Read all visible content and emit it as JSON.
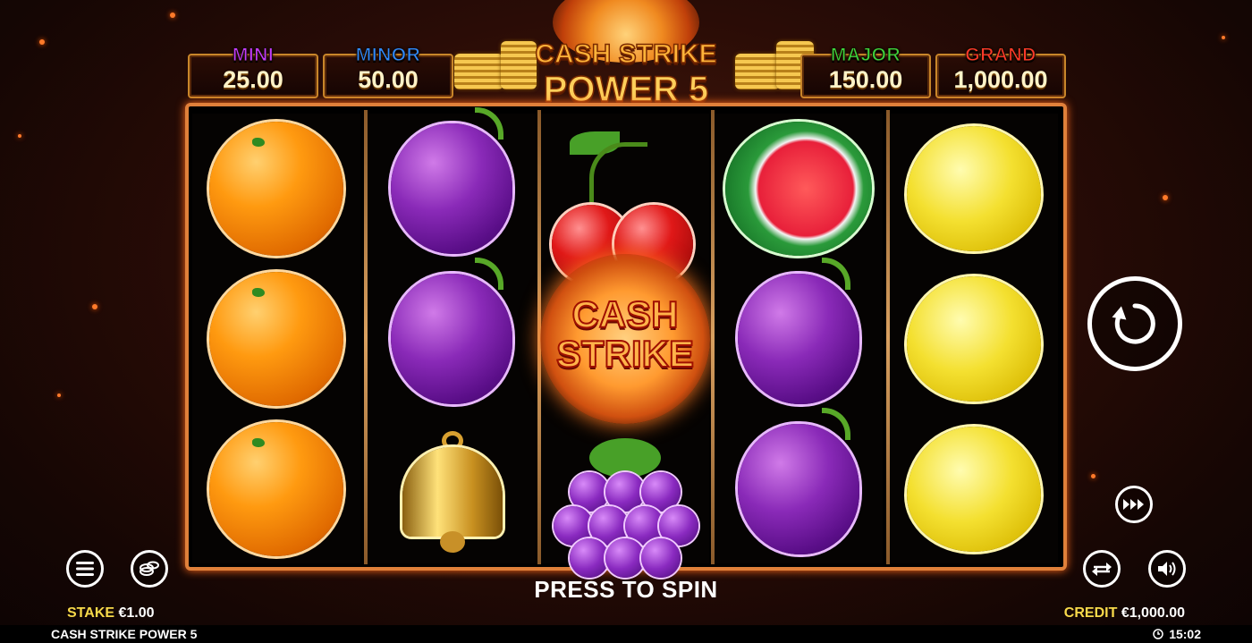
{
  "jackpots": [
    {
      "label": "MINI",
      "value": "25.00",
      "color": "#c23cff"
    },
    {
      "label": "MINOR",
      "value": "50.00",
      "color": "#2e8bff"
    },
    {
      "label": "MAJOR",
      "value": "150.00",
      "color": "#3cd43c"
    },
    {
      "label": "GRAND",
      "value": "1,000.00",
      "color": "#ff3a2a"
    }
  ],
  "logo": {
    "line1": "CASH STRIKE",
    "line2": "POWER 5"
  },
  "reels": [
    [
      "orange",
      "orange",
      "orange"
    ],
    [
      "plum",
      "plum",
      "bell"
    ],
    [
      "cherry",
      "cash-strike",
      "grapes"
    ],
    [
      "watermelon",
      "plum",
      "plum"
    ],
    [
      "lemon",
      "lemon",
      "lemon"
    ]
  ],
  "cash_strike_symbol": {
    "line1": "CASH",
    "line2": "STRIKE"
  },
  "press_to_spin": "PRESS TO SPIN",
  "stake": {
    "label": "STAKE",
    "value": "€1.00"
  },
  "credit": {
    "label": "CREDIT",
    "value": "€1,000.00"
  },
  "game_name": "CASH STRIKE POWER 5",
  "clock": "15:02",
  "icons": {
    "menu": "menu-icon",
    "coins": "coins-icon",
    "spin": "spin-icon",
    "turbo": "fast-forward-icon",
    "autoplay": "autoplay-icon",
    "sound": "speaker-icon",
    "clock": "clock-icon"
  }
}
